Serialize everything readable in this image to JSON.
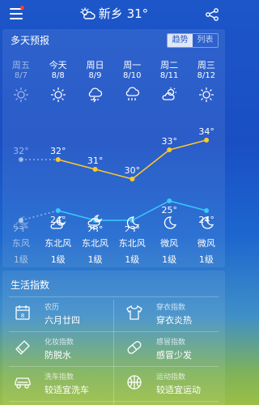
{
  "header": {
    "city": "新乡",
    "temp": "31°"
  },
  "forecast": {
    "title": "多天预报",
    "toggle": {
      "trend": "趋势",
      "list": "列表"
    },
    "days": [
      {
        "name": "周五",
        "date": "8/7",
        "past": true,
        "day_icon": "sun-icon",
        "night_icon": "cloudy-night-icon",
        "wind": "东风",
        "level": "1级"
      },
      {
        "name": "今天",
        "date": "8/8",
        "past": false,
        "day_icon": "sun-icon",
        "night_icon": "cloudy-night-icon",
        "wind": "东北风",
        "level": "1级"
      },
      {
        "name": "周日",
        "date": "8/9",
        "past": false,
        "day_icon": "thunder-shower-icon",
        "night_icon": "thunder-shower-night-icon",
        "wind": "东北风",
        "level": "1级"
      },
      {
        "name": "周一",
        "date": "8/10",
        "past": false,
        "day_icon": "rain-icon",
        "night_icon": "moon-icon",
        "wind": "东北风",
        "level": "1级"
      },
      {
        "name": "周二",
        "date": "8/11",
        "past": false,
        "day_icon": "partly-cloudy-icon",
        "night_icon": "moon-icon",
        "wind": "微风",
        "level": "1级"
      },
      {
        "name": "周三",
        "date": "8/12",
        "past": false,
        "day_icon": "sun-icon",
        "night_icon": "moon-icon",
        "wind": "微风",
        "level": "1级"
      }
    ]
  },
  "chart_data": {
    "type": "line",
    "categories": [
      "8/7",
      "8/8",
      "8/9",
      "8/10",
      "8/11",
      "8/12"
    ],
    "series": [
      {
        "values": [
          32,
          32,
          31,
          30,
          33,
          34
        ],
        "color": "#ffc928"
      },
      {
        "values": [
          23,
          24,
          23,
          23,
          25,
          24
        ],
        "color": "#39c8ff"
      }
    ],
    "labels_high": [
      "32°",
      "32°",
      "31°",
      "30°",
      "33°",
      "34°"
    ],
    "labels_low": [
      "23°",
      "24°",
      "23°",
      "23°",
      "25°",
      "24°"
    ]
  },
  "life": {
    "title": "生活指数",
    "items": [
      {
        "label": "农历",
        "value": "六月廿四",
        "icon": "calendar-icon"
      },
      {
        "label": "穿衣指数",
        "value": "穿衣炎热",
        "icon": "tshirt-icon"
      },
      {
        "label": "化妆指数",
        "value": "防脱水",
        "icon": "lipstick-icon"
      },
      {
        "label": "感冒指数",
        "value": "感冒少发",
        "icon": "pill-icon"
      },
      {
        "label": "洗车指数",
        "value": "较适宜洗车",
        "icon": "car-icon"
      },
      {
        "label": "运动指数",
        "value": "较适宜运动",
        "icon": "ball-icon"
      }
    ]
  }
}
